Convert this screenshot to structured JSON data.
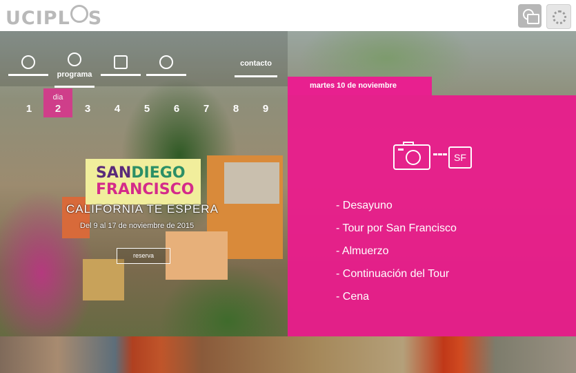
{
  "header": {
    "logo_text": "UCIPL",
    "logo_suffix": "S",
    "buttons": [
      {
        "icon": "plus-window-icon"
      },
      {
        "icon": "settings-gear-icon"
      }
    ]
  },
  "nav": {
    "items": [
      {
        "icon": "pen-icon",
        "label": ""
      },
      {
        "icon": "clock-icon",
        "label": "programa"
      },
      {
        "icon": "restaurant-icon",
        "label": ""
      },
      {
        "icon": "home-icon",
        "label": ""
      }
    ],
    "contacto": "contacto"
  },
  "days": {
    "prefix": "dia",
    "active": 2,
    "list": [
      "1",
      "2",
      "3",
      "4",
      "5",
      "6",
      "7",
      "8",
      "9"
    ]
  },
  "promo": {
    "brand_line1_a": "SAN",
    "brand_line1_b": "DIEGO",
    "brand_line2": "FRANCISCO",
    "tagline": "CALIFORNIA TE ESPERA",
    "dates": "Del 9 al 17 de noviembre de 2015",
    "reserve_button": "reserva"
  },
  "schedule": {
    "date_tab": "martes 10 de noviembre",
    "icon_label": "SF",
    "items": [
      "- Desayuno",
      "- Tour por San Francisco",
      "- Almuerzo",
      "- Continuación del Tour",
      "- Cena"
    ]
  },
  "colors": {
    "accent": "#e91c8c",
    "brand_bg": "#f1ee9c"
  }
}
